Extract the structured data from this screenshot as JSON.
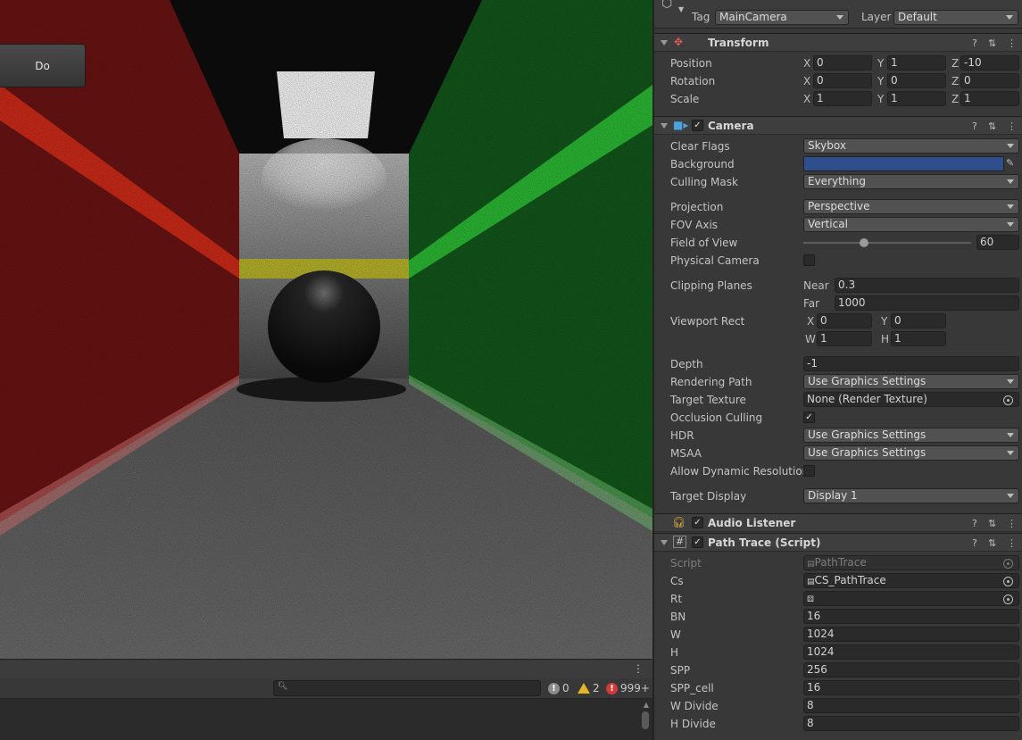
{
  "scene": {
    "do_button": "Do"
  },
  "console": {
    "search_placeholder": "",
    "info_count": "0",
    "warning_count": "2",
    "error_count": "999+"
  },
  "gameobject": {
    "tag_label": "Tag",
    "tag_value": "MainCamera",
    "layer_label": "Layer",
    "layer_value": "Default"
  },
  "transform": {
    "title": "Transform",
    "position_label": "Position",
    "position": {
      "x": "0",
      "y": "1",
      "z": "-10"
    },
    "rotation_label": "Rotation",
    "rotation": {
      "x": "0",
      "y": "0",
      "z": "0"
    },
    "scale_label": "Scale",
    "scale": {
      "x": "1",
      "y": "1",
      "z": "1"
    }
  },
  "camera": {
    "title": "Camera",
    "clear_flags_label": "Clear Flags",
    "clear_flags": "Skybox",
    "background_label": "Background",
    "background_color": "#2e4f8c",
    "culling_mask_label": "Culling Mask",
    "culling_mask": "Everything",
    "projection_label": "Projection",
    "projection": "Perspective",
    "fov_axis_label": "FOV Axis",
    "fov_axis": "Vertical",
    "fov_label": "Field of View",
    "fov": "60",
    "fov_slider_fraction": 0.36,
    "physical_label": "Physical Camera",
    "clipping_label": "Clipping Planes",
    "near_label": "Near",
    "near": "0.3",
    "far_label": "Far",
    "far": "1000",
    "viewport_label": "Viewport Rect",
    "vp_x": "0",
    "vp_y": "0",
    "vp_w": "1",
    "vp_h": "1",
    "depth_label": "Depth",
    "depth": "-1",
    "rendering_path_label": "Rendering Path",
    "rendering_path": "Use Graphics Settings",
    "target_texture_label": "Target Texture",
    "target_texture": "None (Render Texture)",
    "occlusion_label": "Occlusion Culling",
    "hdr_label": "HDR",
    "hdr": "Use Graphics Settings",
    "msaa_label": "MSAA",
    "msaa": "Use Graphics Settings",
    "dynres_label": "Allow Dynamic Resolution",
    "target_display_label": "Target Display",
    "target_display": "Display 1"
  },
  "audio": {
    "title": "Audio Listener"
  },
  "pathtrace": {
    "title": "Path Trace (Script)",
    "script_label": "Script",
    "script": "PathTrace",
    "cs_label": "Cs",
    "cs": "CS_PathTrace",
    "rt_label": "Rt",
    "bn_label": "BN",
    "bn": "16",
    "w_label": "W",
    "w": "1024",
    "h_label": "H",
    "h": "1024",
    "spp_label": "SPP",
    "spp": "256",
    "sppcell_label": "SPP_cell",
    "sppcell": "16",
    "wdiv_label": "W Divide",
    "wdiv": "8",
    "hdiv_label": "H Divide",
    "hdiv": "8"
  }
}
